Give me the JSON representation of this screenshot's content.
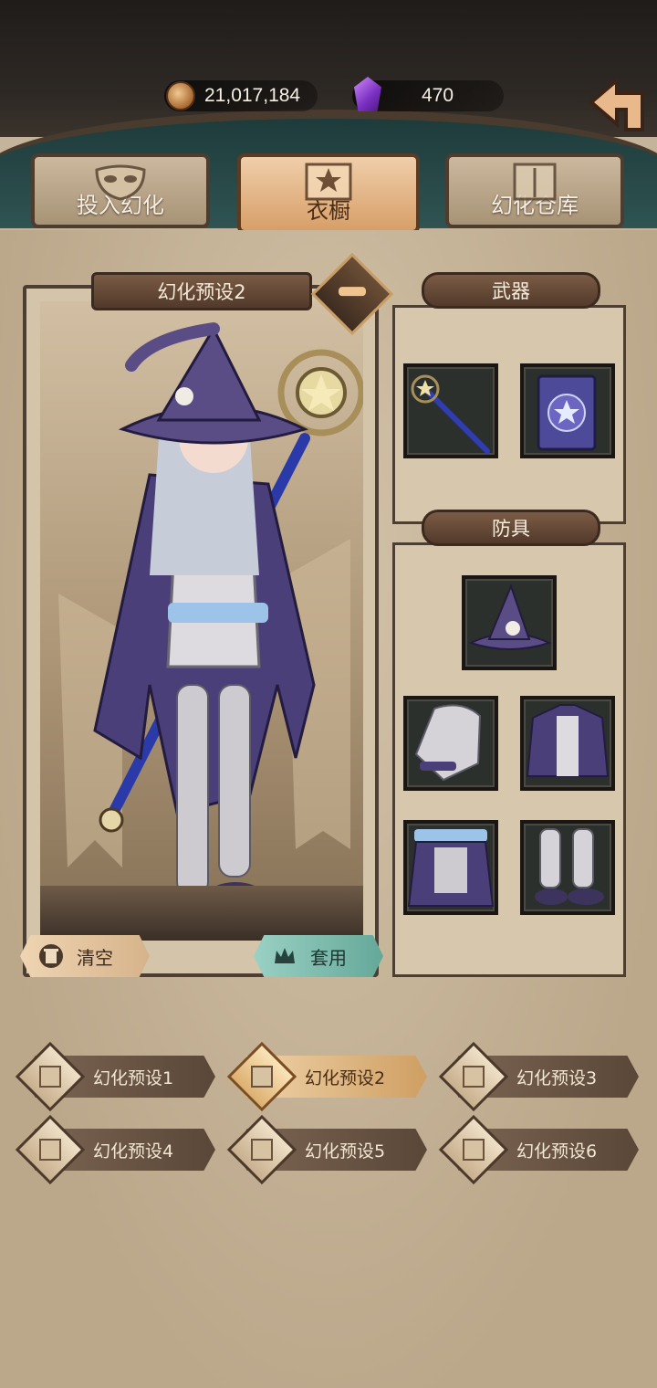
{
  "currency": {
    "gold_value": "21,017,184",
    "gem_value": "470"
  },
  "tabs": [
    {
      "label": "投入幻化",
      "active": false
    },
    {
      "label": "衣橱",
      "active": true
    },
    {
      "label": "幻化仓库",
      "active": false
    }
  ],
  "preview": {
    "title": "幻化预设2",
    "clear_label": "清空",
    "apply_label": "套用"
  },
  "weapon_section": {
    "title": "武器"
  },
  "armor_section": {
    "title": "防具"
  },
  "presets": [
    {
      "label": "幻化预设1",
      "active": false
    },
    {
      "label": "幻化预设2",
      "active": true
    },
    {
      "label": "幻化预设3",
      "active": false
    },
    {
      "label": "幻化预设4",
      "active": false
    },
    {
      "label": "幻化预设5",
      "active": false
    },
    {
      "label": "幻化预设6",
      "active": false
    }
  ],
  "colors": {
    "accent_gold": "#d79f68",
    "apply_teal": "#64a899",
    "outfit_purple": "#4b3f7a"
  },
  "icons": [
    "coin-icon",
    "gem-icon",
    "back-arrow-icon",
    "mask-icon",
    "wardrobe-icon",
    "cabinet-icon",
    "edit-feather-icon",
    "trash-icon",
    "crown-icon",
    "staff-icon",
    "spellbook-icon",
    "witch-hat-icon",
    "gloves-icon",
    "coat-icon",
    "skirt-icon",
    "boots-icon"
  ]
}
